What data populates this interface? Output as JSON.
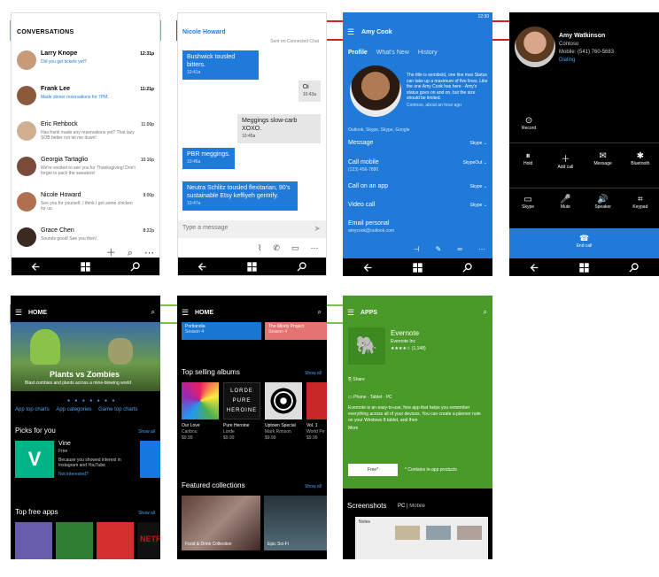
{
  "conversations": {
    "title": "CONVERSATIONS",
    "items": [
      {
        "name": "Larry Knope",
        "time": "12:31p",
        "msg": "Did you get tickets yet?",
        "blue": true
      },
      {
        "name": "Frank Lee",
        "time": "11:21p",
        "msg": "Made dinner reservations for 7PM.",
        "blue": true
      },
      {
        "name": "Eric Rehbock",
        "time": "11:00p",
        "msg": "Has frank made any reservations yet? That lazy SOB better not let me down!",
        "blue": false
      },
      {
        "name": "Georgia Tartaglio",
        "time": "10:16p",
        "msg": "We're excited to see you for Thanksgiving! Don't forget to pack the sweaters!",
        "blue": false
      },
      {
        "name": "Nicole Howard",
        "time": "9:00p",
        "msg": "See you for yourself. I think I got some chicken for us.",
        "blue": false
      },
      {
        "name": "Grace Chen",
        "time": "8:22p",
        "msg": "Sounds good! See you then!",
        "blue": false
      }
    ]
  },
  "chat": {
    "name": "Nicole Howard",
    "top_note": "Sent on Connected Chat",
    "placeholder": "Type a message",
    "messages": [
      {
        "side": "l",
        "text": "Bushwick tousled bitters.",
        "time": "10:41a"
      },
      {
        "side": "r",
        "text": "Oi",
        "time": "10:43a"
      },
      {
        "side": "r",
        "text": "Meggings slow-carb XOXO.",
        "time": "10:45a"
      },
      {
        "side": "l",
        "text": "PBR meggings.",
        "time": "10:46a"
      },
      {
        "side": "l",
        "text": "Neutra Schlitz tousled flexitarian, 90's sustainable Etsy keffiyeh gentrify.",
        "time": "10:47a"
      }
    ]
  },
  "contact": {
    "status_time": "12:30",
    "name": "Amy Cook",
    "tabs": [
      "Profile",
      "What's New",
      "History"
    ],
    "quote": "The title is semibold, one line max Status can take up a maximum of five lines. Like the one Amy Cook has here - Amy's status goes on and on, but the size should be limited.",
    "quote_src": "Contoso, about an hour ago",
    "services": "Outlook, Skype, Skype, Google",
    "actions": [
      {
        "label": "Message",
        "via": "Skype"
      },
      {
        "label": "Call mobile",
        "sub": "(123) 456-7890",
        "via": "SkypeOut"
      },
      {
        "label": "Call on an app",
        "via": "Skype"
      },
      {
        "label": "Video call",
        "via": "Skype"
      },
      {
        "label": "Email personal",
        "sub": "amycook@outlook.com"
      }
    ]
  },
  "call": {
    "name": "Amy Watkinson",
    "company": "Contoso",
    "number": "Mobile: (541) 760-5683",
    "state": "Dialing",
    "record": "Record",
    "buttons1": [
      "Hold",
      "Add call",
      "Message",
      "Bluetooth"
    ],
    "buttons2": [
      "Skype",
      "Mute",
      "Speaker",
      "Keypad"
    ],
    "end": "End call"
  },
  "store": {
    "header": "HOME",
    "hero": "Plants vs Zombies",
    "hero_sub": "Blast zombies and plants across a mine-blowing world",
    "links": [
      "App top charts",
      "App categories",
      "Game top charts"
    ],
    "picks_title": "Picks for you",
    "show_all": "Show all",
    "pick": {
      "name": "Vine",
      "price": "Free",
      "desc": "Because you showed interest in Instagram and YouTube",
      "action": "Not interested?"
    },
    "free_title": "Top free apps"
  },
  "music": {
    "header": "HOME",
    "tiles": [
      "Portlandia",
      "The Mindy Project"
    ],
    "tile_subs": [
      "Season 4",
      "Season 4"
    ],
    "albums_title": "Top selling albums",
    "albums": [
      {
        "title": "Our Love",
        "artist": "Caribou",
        "price": "$9.99"
      },
      {
        "title": "Pure Heroine",
        "artist": "Lorde",
        "price": "$9.99"
      },
      {
        "title": "Uptown Special",
        "artist": "Mark Ronson",
        "price": "$9.99"
      },
      {
        "title": "Vol. 1",
        "artist": "World Pe",
        "price": "$9.99"
      }
    ],
    "lorde": [
      "LORDE",
      "PURE",
      "HEROINE"
    ],
    "featured_title": "Featured collections",
    "collections": [
      "Food & Drink Collection",
      "Epic Sci-Fi"
    ]
  },
  "apps": {
    "header": "APPS",
    "app": "Evernote",
    "publisher": "Evernote Inc",
    "rating": "★★★★☆ (1,148)",
    "share": "Share",
    "devices": "Phone · Tablet · PC",
    "desc": "Evernote is an easy-to-use, free app that helps you remember everything across all of your devices. You can create a planner note on your Windows 8 tablet, and then",
    "more": "More",
    "free": "Free*",
    "note": "* Contains in-app products",
    "screens": "Screenshots",
    "screens_tabs": [
      "PC",
      "Mobile"
    ],
    "notes_label": "Notes"
  },
  "colors": {
    "blue": "#1f7ad9",
    "green": "#4a9a2a",
    "red": "#d51f24",
    "highlight_green": "#7dc242"
  }
}
